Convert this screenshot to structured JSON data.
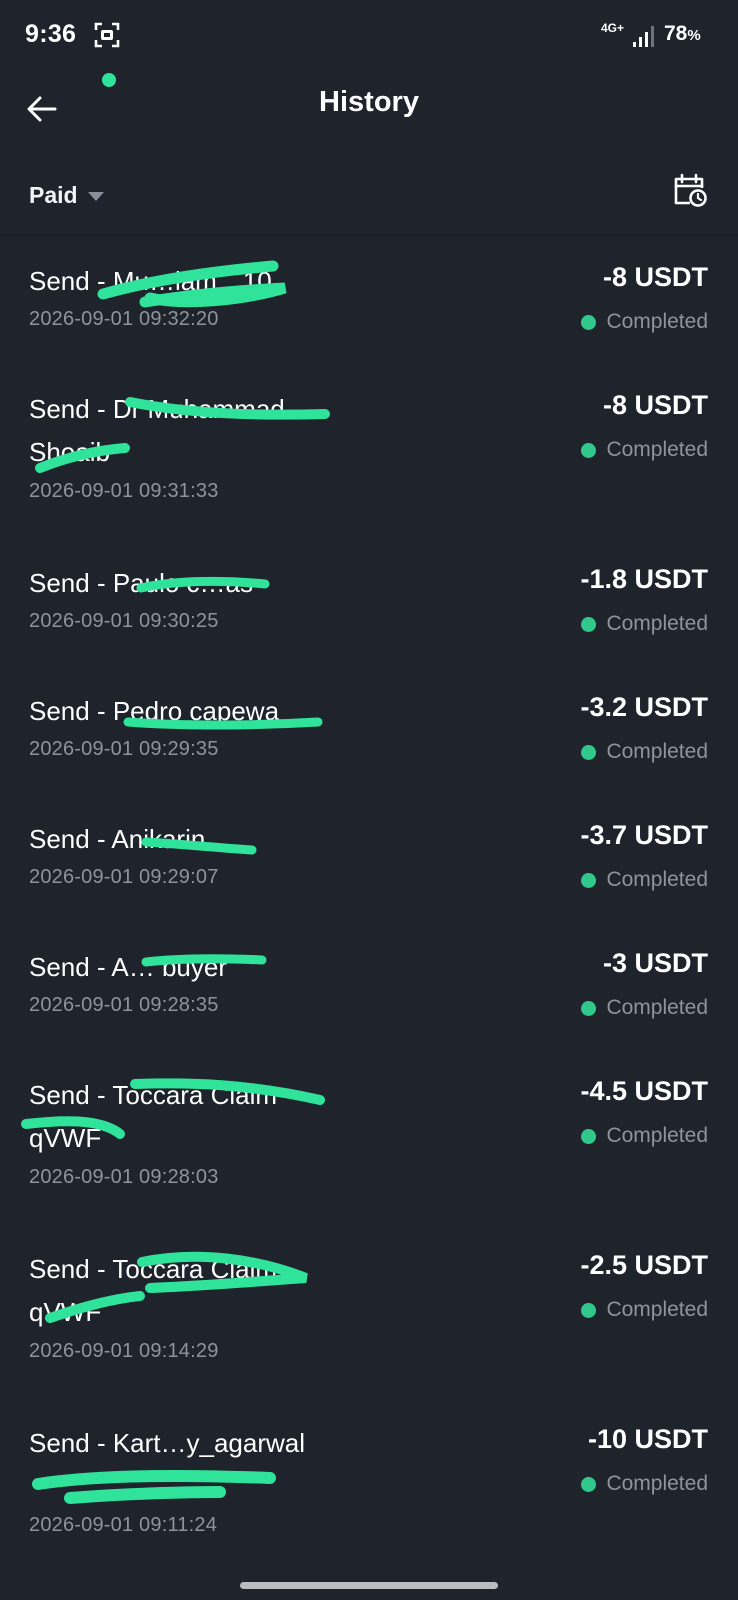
{
  "status_bar": {
    "time": "9:36",
    "network": "4G+",
    "battery": "78",
    "battery_unit": "%"
  },
  "header": {
    "title": "History"
  },
  "filter": {
    "label": "Paid"
  },
  "transactions": [
    {
      "title": "Send - Mu…lam…10",
      "date": "2026-09-01 09:32:20",
      "amount": "-8 USDT",
      "status": "Completed"
    },
    {
      "title": "Send - Dr Muhammad Shoaib",
      "date": "2026-09-01 09:31:33",
      "amount": "-8 USDT",
      "status": "Completed"
    },
    {
      "title": "Send - Paulo c…as",
      "date": "2026-09-01 09:30:25",
      "amount": "-1.8 USDT",
      "status": "Completed"
    },
    {
      "title": "Send - Pedro capewa",
      "date": "2026-09-01 09:29:35",
      "amount": "-3.2 USDT",
      "status": "Completed"
    },
    {
      "title": "Send - Anikarin",
      "date": "2026-09-01 09:29:07",
      "amount": "-3.7 USDT",
      "status": "Completed"
    },
    {
      "title": "Send - A… buyer",
      "date": "2026-09-01 09:28:35",
      "amount": "-3 USDT",
      "status": "Completed"
    },
    {
      "title": "Send - Toccara Claim qVWF",
      "date": "2026-09-01 09:28:03",
      "amount": "-4.5 USDT",
      "status": "Completed"
    },
    {
      "title": "Send - Toccara Claim qVWF",
      "date": "2026-09-01 09:14:29",
      "amount": "-2.5 USDT",
      "status": "Completed"
    },
    {
      "title": "Send - Kart…y_agarwal",
      "date": "2026-09-01 09:11:24",
      "amount": "-10 USDT",
      "status": "Completed"
    }
  ],
  "colors": {
    "background": "#1e232c",
    "status_completed": "#31c98b",
    "redaction": "#2fe39a"
  }
}
